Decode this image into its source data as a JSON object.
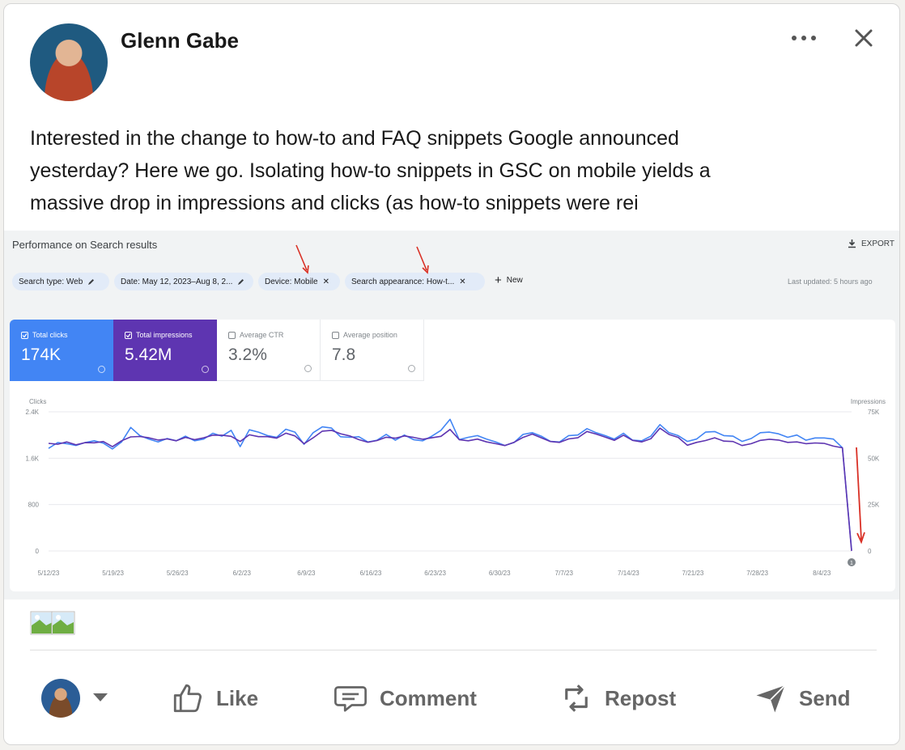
{
  "post": {
    "author": "Glenn Gabe",
    "text_lines": [
      "Interested in the change to how-to and FAQ snippets Google announced",
      "yesterday? Here we go. Isolating how-to snippets in GSC on mobile yields a",
      "massive drop in impressions and clicks (as how-to snippets were rei"
    ]
  },
  "icons": {
    "more": "more-horizontal-icon",
    "close": "close-icon"
  },
  "screenshot": {
    "title": "Performance on Search results",
    "export_label": "EXPORT",
    "filters": [
      "Search type: Web",
      "Date: May 12, 2023–Aug 8, 2...",
      "Device: Mobile",
      "Search appearance: How-t..."
    ],
    "new_label": "New",
    "last_updated": "Last updated: 5 hours ago",
    "metrics": [
      {
        "label": "Total clicks",
        "value": "174K"
      },
      {
        "label": "Total impressions",
        "value": "5.42M"
      },
      {
        "label": "Average CTR",
        "value": "3.2%"
      },
      {
        "label": "Average position",
        "value": "7.8"
      }
    ],
    "colors": {
      "clicks": "#4285f4",
      "impressions": "#5e35b1",
      "arrow": "#d93025"
    }
  },
  "chart_data": {
    "type": "line",
    "left_axis_label": "Clicks",
    "right_axis_label": "Impressions",
    "y_ticks": [
      "2.4K",
      "1.6K",
      "800",
      "0"
    ],
    "y2_ticks": [
      "75K",
      "50K",
      "25K",
      "0"
    ],
    "ylim": [
      0,
      2400
    ],
    "y2lim": [
      0,
      75000
    ],
    "x_tick_labels": [
      "5/12/23",
      "5/19/23",
      "5/26/23",
      "6/2/23",
      "6/9/23",
      "6/16/23",
      "6/23/23",
      "6/30/23",
      "7/7/23",
      "7/14/23",
      "7/21/23",
      "7/28/23",
      "8/4/23"
    ],
    "x": [
      "5/12",
      "5/13",
      "5/14",
      "5/15",
      "5/16",
      "5/17",
      "5/18",
      "5/19",
      "5/20",
      "5/21",
      "5/22",
      "5/23",
      "5/24",
      "5/25",
      "5/26",
      "5/27",
      "5/28",
      "5/29",
      "5/30",
      "5/31",
      "6/1",
      "6/2",
      "6/3",
      "6/4",
      "6/5",
      "6/6",
      "6/7",
      "6/8",
      "6/9",
      "6/10",
      "6/11",
      "6/12",
      "6/13",
      "6/14",
      "6/15",
      "6/16",
      "6/17",
      "6/18",
      "6/19",
      "6/20",
      "6/21",
      "6/22",
      "6/23",
      "6/24",
      "6/25",
      "6/26",
      "6/27",
      "6/28",
      "6/29",
      "6/30",
      "7/1",
      "7/2",
      "7/3",
      "7/4",
      "7/5",
      "7/6",
      "7/7",
      "7/8",
      "7/9",
      "7/10",
      "7/11",
      "7/12",
      "7/13",
      "7/14",
      "7/15",
      "7/16",
      "7/17",
      "7/18",
      "7/19",
      "7/20",
      "7/21",
      "7/22",
      "7/23",
      "7/24",
      "7/25",
      "7/26",
      "7/27",
      "7/28",
      "7/29",
      "7/30",
      "7/31",
      "8/1",
      "8/2",
      "8/3",
      "8/4",
      "8/5",
      "8/6",
      "8/7",
      "8/8"
    ],
    "series": [
      {
        "name": "Total clicks",
        "values": [
          1770,
          1870,
          1850,
          1820,
          1870,
          1900,
          1860,
          1760,
          1880,
          2130,
          1990,
          1930,
          1880,
          1940,
          1900,
          1980,
          1900,
          1930,
          2030,
          1980,
          2080,
          1800,
          2090,
          2050,
          1990,
          1960,
          2100,
          2050,
          1840,
          2040,
          2140,
          2120,
          1970,
          1960,
          1970,
          1880,
          1910,
          2010,
          1910,
          2000,
          1920,
          1900,
          1980,
          2080,
          2270,
          1920,
          1960,
          1990,
          1930,
          1880,
          1820,
          1870,
          2010,
          2040,
          1980,
          1890,
          1880,
          1990,
          2000,
          2110,
          2040,
          1990,
          1930,
          2030,
          1910,
          1900,
          1980,
          2180,
          2040,
          1990,
          1890,
          1930,
          2050,
          2060,
          1990,
          1980,
          1890,
          1940,
          2040,
          2050,
          2020,
          1960,
          2000,
          1910,
          1950,
          1950,
          1930,
          1780,
          20
        ]
      },
      {
        "name": "Total impressions",
        "values": [
          58000,
          57500,
          58800,
          57200,
          58400,
          58300,
          59000,
          56200,
          59400,
          61500,
          61700,
          61000,
          59800,
          60400,
          59400,
          61200,
          60000,
          61000,
          62400,
          62400,
          61800,
          59000,
          62600,
          61600,
          61600,
          60800,
          63500,
          62000,
          57800,
          61000,
          64600,
          65000,
          63200,
          62000,
          60000,
          58600,
          59500,
          61300,
          60800,
          62000,
          61200,
          60200,
          61000,
          61800,
          65500,
          60000,
          59400,
          60300,
          58800,
          57800,
          56800,
          58500,
          61200,
          63000,
          61000,
          59000,
          58500,
          60400,
          61000,
          64400,
          63000,
          61400,
          59600,
          62400,
          59600,
          58800,
          60500,
          66200,
          62800,
          61200,
          57000,
          58500,
          59500,
          61000,
          59200,
          59000,
          56800,
          57800,
          59600,
          60200,
          59800,
          58500,
          58800,
          57800,
          58200,
          58000,
          56500,
          55600,
          0
        ]
      }
    ]
  },
  "actions": {
    "like": "Like",
    "comment": "Comment",
    "repost": "Repost",
    "send": "Send"
  }
}
